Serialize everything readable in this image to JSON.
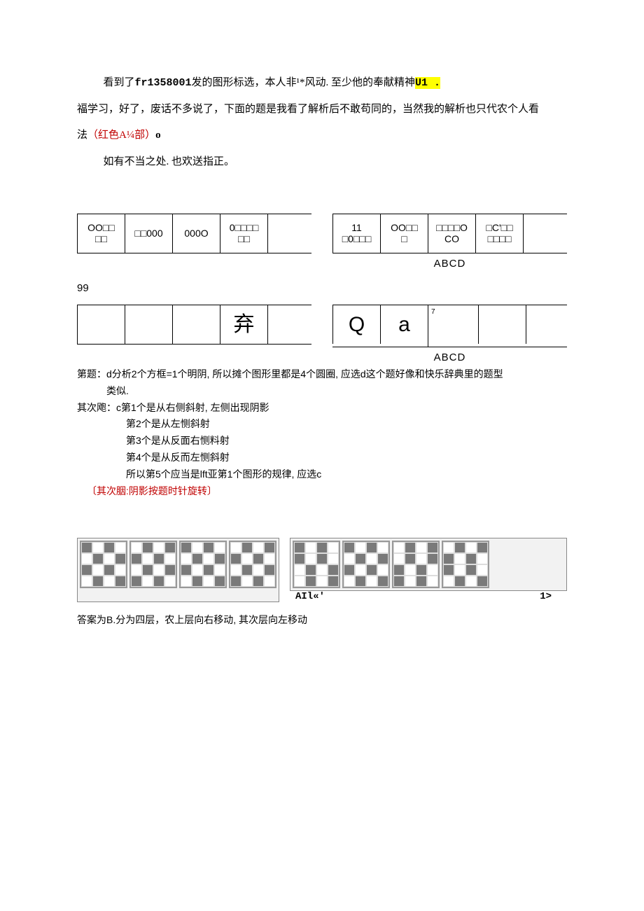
{
  "intro": {
    "l1a": "看到了",
    "l1b": "fr1358001",
    "l1c": "发的图形标选，本人非¹*风动. 至少他的奉献精神",
    "l1d": "U1 .",
    "l2": "福学习，好了，废话不多说了，下面的题是我看了解析后不敢苟同的，当然我的解析也只代农个人看",
    "l3a": "法",
    "l3b": "（红色A¼部）",
    "l3c": "o",
    "l4": "如有不当之处. 也欢送指正。"
  },
  "row1": {
    "left": [
      "OO□□\n□□",
      "□□000",
      "000O",
      "0□□□□\n□□"
    ],
    "right": [
      "11\n□0□□□",
      "OO□□\n□",
      "□□□□O\nCO",
      "□C'□□\n□□□□"
    ],
    "abcd": "ABCD"
  },
  "q99": "99",
  "row2": {
    "left": [
      "",
      "",
      "",
      "弃"
    ],
    "right": [
      "Q",
      "a",
      "7",
      ""
    ],
    "abcd": "ABCD"
  },
  "analysis": {
    "t1": "第题：d分析2个方框=1个明阴, 所以摊个图形里都是4个圆圈, 应选d这个题好像和快乐辞典里的题型",
    "t1b": "类似.",
    "t2": "其次飑：c第1个是从右侧斜射, 左侧出现阴影",
    "t3": "第2个是从左恻斜射",
    "t4": "第3个是从反面右恻料射",
    "t5": "第4个是从反而左恻斜射",
    "t6": "所以第5个应当是lft亚第1个图形的规律, 应选c",
    "t7": "〔其次胭:阴影按题时针旋转〕"
  },
  "gridnote": {
    "a": "AIl«'",
    "b": "1>"
  },
  "answerB": "答案为B.分为四层，农上层向右移动, 其次层向左移动"
}
